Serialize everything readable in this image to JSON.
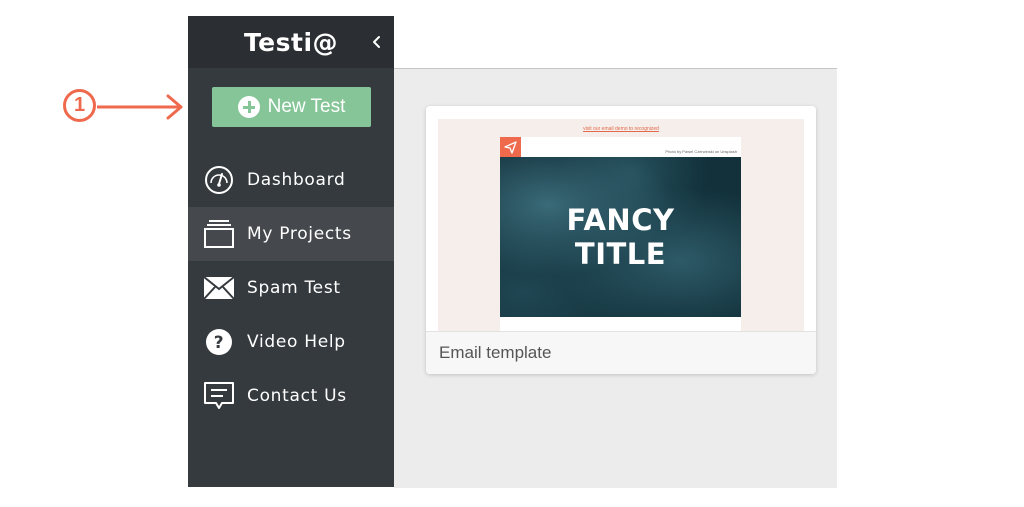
{
  "annotation": {
    "step_number": "1",
    "color": "#ef6a4d"
  },
  "sidebar": {
    "logo_text": "Testi@",
    "collapse_icon": "chevron-left-icon",
    "new_test_label": "New Test",
    "items": [
      {
        "label": "Dashboard",
        "icon": "gauge-icon",
        "active": false
      },
      {
        "label": "My Projects",
        "icon": "folder-stack-icon",
        "active": true
      },
      {
        "label": "Spam Test",
        "icon": "envelope-icon",
        "active": false
      },
      {
        "label": "Video Help",
        "icon": "question-circle-icon",
        "active": false
      },
      {
        "label": "Contact Us",
        "icon": "chat-bubble-icon",
        "active": false
      }
    ]
  },
  "content": {
    "card": {
      "caption": "Email template",
      "preview": {
        "top_link": "visit our email demo to recognized",
        "photo_credit": "Photo by Pawel Czerwinski on Unsplash",
        "hero_line1": "FANCY",
        "hero_line2": "TITLE"
      }
    }
  },
  "colors": {
    "sidebar_bg": "#353a3e",
    "sidebar_header_bg": "#2b2f33",
    "active_item_bg": "#45494d",
    "new_test_button": "#86c598",
    "content_bg": "#ececec",
    "accent": "#ef6a4d"
  }
}
